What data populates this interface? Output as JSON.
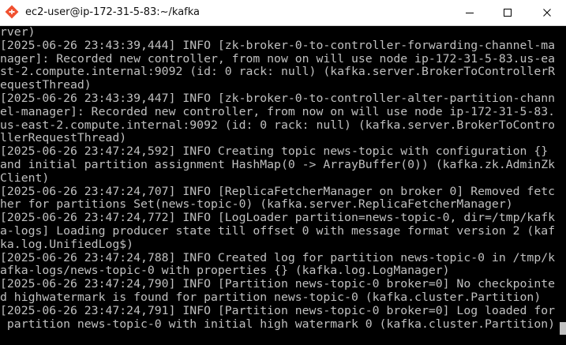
{
  "window": {
    "title": "ec2-user@ip-172-31-5-83:~/kafka",
    "icon": "git-bash-diamond-icon",
    "controls": [
      "minimize-icon",
      "maximize-icon",
      "close-icon"
    ]
  },
  "terminal": {
    "lines": [
      "rver)",
      "[2025-06-26 23:43:39,444] INFO [zk-broker-0-to-controller-forwarding-channel-ma",
      "nager]: Recorded new controller, from now on will use node ip-172-31-5-83.us-ea",
      "st-2.compute.internal:9092 (id: 0 rack: null) (kafka.server.BrokerToControllerR",
      "equestThread)",
      "[2025-06-26 23:43:39,447] INFO [zk-broker-0-to-controller-alter-partition-chann",
      "el-manager]: Recorded new controller, from now on will use node ip-172-31-5-83.",
      "us-east-2.compute.internal:9092 (id: 0 rack: null) (kafka.server.BrokerToContro",
      "llerRequestThread)",
      "[2025-06-26 23:47:24,592] INFO Creating topic news-topic with configuration {}",
      "and initial partition assignment HashMap(0 -> ArrayBuffer(0)) (kafka.zk.AdminZk",
      "Client)",
      "[2025-06-26 23:47:24,707] INFO [ReplicaFetcherManager on broker 0] Removed fetc",
      "her for partitions Set(news-topic-0) (kafka.server.ReplicaFetcherManager)",
      "[2025-06-26 23:47:24,772] INFO [LogLoader partition=news-topic-0, dir=/tmp/kafk",
      "a-logs] Loading producer state till offset 0 with message format version 2 (kaf",
      "ka.log.UnifiedLog$)",
      "[2025-06-26 23:47:24,788] INFO Created log for partition news-topic-0 in /tmp/k",
      "afka-logs/news-topic-0 with properties {} (kafka.log.LogManager)",
      "[2025-06-26 23:47:24,790] INFO [Partition news-topic-0 broker=0] No checkpointe",
      "d highwatermark is found for partition news-topic-0 (kafka.cluster.Partition)",
      "[2025-06-26 23:47:24,791] INFO [Partition news-topic-0 broker=0] Log loaded for",
      " partition news-topic-0 with initial high watermark 0 (kafka.cluster.Partition)"
    ]
  },
  "colors": {
    "terminal_bg": "#000000",
    "terminal_fg": "#c0c0c0",
    "titlebar_bg": "#ffffff"
  }
}
